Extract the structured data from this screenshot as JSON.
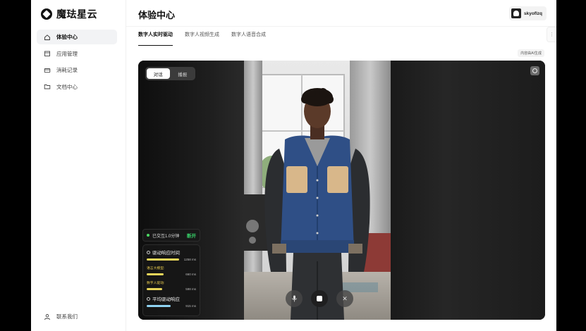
{
  "brand": {
    "name": "魔珐星云"
  },
  "sidebar": {
    "items": [
      {
        "label": "体验中心",
        "icon": "home-icon",
        "active": true
      },
      {
        "label": "应用管理",
        "icon": "calendar-icon",
        "active": false
      },
      {
        "label": "消耗记录",
        "icon": "card-icon",
        "active": false
      },
      {
        "label": "文档中心",
        "icon": "folder-icon",
        "active": false
      }
    ],
    "contact_label": "联系我们"
  },
  "header": {
    "title": "体验中心",
    "username": "skyoflzq"
  },
  "tabs": [
    {
      "label": "数字人实时驱动",
      "active": true
    },
    {
      "label": "数字人视频生成",
      "active": false
    },
    {
      "label": "数字人语音合成",
      "active": false
    }
  ],
  "ai_note": "内容由AI生成",
  "stage": {
    "mode_options": [
      "对话",
      "播报"
    ],
    "mode_selected": "对话",
    "session_text": "已交互1.0分钟",
    "disconnect_label": "断开"
  },
  "metrics": {
    "drive_title": "驱动响应时间",
    "drive_value": "1258 ms",
    "lm_label": "语言大模型:",
    "lm_value": "660 ms",
    "dh_label": "数字人驱动:",
    "dh_value": "598 ms",
    "avg_title": "平均驱动响应",
    "avg_value": "915 ms",
    "colors": {
      "yellow": "#e8d55a",
      "blue": "#8fd3f2"
    }
  }
}
